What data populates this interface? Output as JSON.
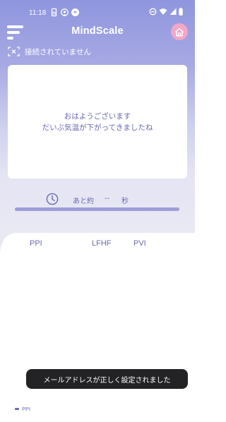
{
  "status_bar": {
    "time": "11:18",
    "left_icons": [
      "sim-card-icon",
      "location-pin-icon",
      "app-notification-icon"
    ],
    "right_icons": [
      "do-not-disturb-icon",
      "wifi-icon",
      "cell-signal-icon",
      "battery-icon"
    ]
  },
  "header": {
    "title": "MindScale",
    "menu_icon": "menu-icon",
    "home_icon": "home-icon"
  },
  "connection": {
    "status_text": "接続されていません",
    "icon": "disconnected-icon"
  },
  "message": {
    "line1": "おはようございます",
    "line2": "だいぶ気温が下がってきましたね"
  },
  "timer": {
    "icon": "clock-icon",
    "prefix": "あと約",
    "value": "--",
    "unit": "秒",
    "progress": 1.0
  },
  "metrics": [
    "PPI",
    "LFHF",
    "PVI"
  ],
  "toast": {
    "text": "メールアドレスが正しく設定されました"
  },
  "legend": {
    "label": "PPI"
  },
  "colors": {
    "accent": "#6a6ab2",
    "header_gradient_top": "#8f96de",
    "home_button": "#f3a6c8",
    "toast_bg": "#232326"
  }
}
